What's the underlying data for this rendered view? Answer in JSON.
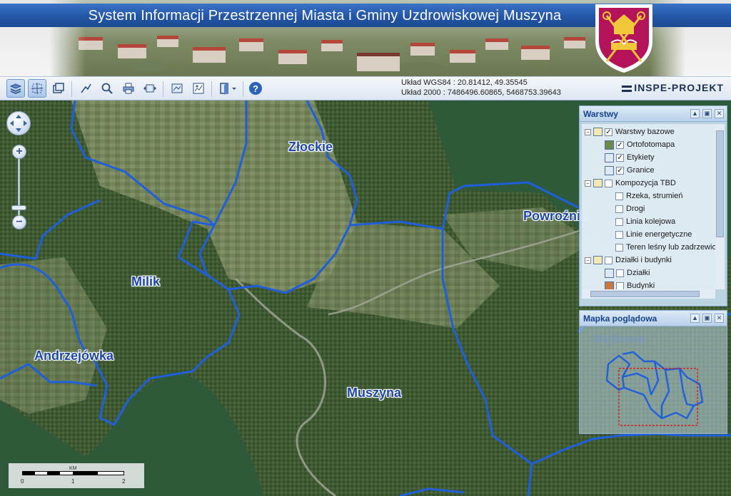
{
  "header": {
    "title": "System Informacji Przestrzennej Miasta i Gminy Uzdrowiskowej Muszyna"
  },
  "toolbar": {
    "tools": [
      {
        "name": "layers-tool-icon",
        "active": true
      },
      {
        "name": "select-tool-icon",
        "active": true
      },
      {
        "name": "window-tool-icon",
        "active": false
      },
      {
        "name": "measure-tool-icon",
        "active": false
      },
      {
        "name": "zoom-tool-icon",
        "active": false
      },
      {
        "name": "print-tool-icon",
        "active": false
      },
      {
        "name": "extent-tool-icon",
        "active": false
      },
      {
        "name": "info-tool-icon",
        "active": false
      },
      {
        "name": "map-tool-icon",
        "active": false
      },
      {
        "name": "export-tool-icon",
        "active": false
      },
      {
        "name": "help-icon",
        "active": false
      }
    ],
    "coords_wgs84": "Układ WGS84 : 20.81412, 49.35545",
    "coords_2000": "Układ 2000 : 7486496.60865, 5468753.39643",
    "brand": "INSPE-PROJEKT"
  },
  "map": {
    "labels": {
      "zlockie": "Złockie",
      "milik": "Milik",
      "powroznik": "Powroźnik",
      "andrzejowka": "Andrzejówka",
      "muszyna": "Muszyna"
    },
    "scale": {
      "unit": "KM",
      "ticks": [
        "0",
        "1",
        "2"
      ]
    },
    "colors": {
      "boundary": "#1f5fdc",
      "land_dark": "#2e5a3a",
      "label": "#1b46a8"
    }
  },
  "layers_panel": {
    "title": "Warstwy",
    "rows": [
      {
        "label": "Warstwy bazowe",
        "checked": true
      },
      {
        "label": "Ortofotomapa",
        "checked": true
      },
      {
        "label": "Etykiety",
        "checked": true
      },
      {
        "label": "Granice",
        "checked": true
      },
      {
        "label": "Kompozycja TBD",
        "checked": false
      },
      {
        "label": "Rzeka, strumień",
        "checked": false
      },
      {
        "label": "Drogi",
        "checked": false
      },
      {
        "label": "Linia kolejowa",
        "checked": false
      },
      {
        "label": "Linie energetyczne",
        "checked": false
      },
      {
        "label": "Teren leśny lub zadrzewio",
        "checked": false
      },
      {
        "label": "Działki i budynki",
        "checked": false
      },
      {
        "label": "Działki",
        "checked": false
      },
      {
        "label": "Budynki",
        "checked": false
      }
    ]
  },
  "overview_panel": {
    "title": "Mapka poglądowa",
    "label": "Wojkowa"
  }
}
